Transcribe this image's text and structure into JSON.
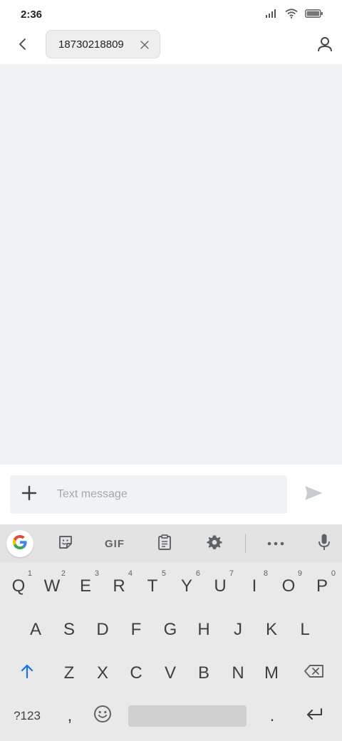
{
  "status_bar": {
    "time": "2:36",
    "icons": [
      "signal-icon",
      "wifi-icon",
      "battery-icon"
    ]
  },
  "header": {
    "back_icon": "back-arrow-icon",
    "recipient": "18730218809",
    "chip_close_icon": "close-icon",
    "contact_icon": "person-icon"
  },
  "compose": {
    "add_icon": "plus-icon",
    "placeholder": "Text message",
    "value": "",
    "send_icon": "send-icon"
  },
  "keyboard": {
    "toolbar": {
      "items": [
        "google-icon",
        "sticker-icon",
        "gif-icon",
        "clipboard-icon",
        "settings-icon",
        "more-icon",
        "microphone-icon"
      ],
      "gif_label": "GIF"
    },
    "row1": [
      {
        "label": "Q",
        "hint": "1"
      },
      {
        "label": "W",
        "hint": "2"
      },
      {
        "label": "E",
        "hint": "3"
      },
      {
        "label": "R",
        "hint": "4"
      },
      {
        "label": "T",
        "hint": "5"
      },
      {
        "label": "Y",
        "hint": "6"
      },
      {
        "label": "U",
        "hint": "7"
      },
      {
        "label": "I",
        "hint": "8"
      },
      {
        "label": "O",
        "hint": "9"
      },
      {
        "label": "P",
        "hint": "0"
      }
    ],
    "row2": [
      "A",
      "S",
      "D",
      "F",
      "G",
      "H",
      "J",
      "K",
      "L"
    ],
    "row3": [
      "Z",
      "X",
      "C",
      "V",
      "B",
      "N",
      "M"
    ],
    "row4": {
      "symbols_label": "?123",
      "comma_label": ",",
      "period_label": "."
    },
    "colors": {
      "background": "#e9e9e9",
      "key_text": "#3c4043",
      "shift_accent": "#1a73e8"
    }
  }
}
